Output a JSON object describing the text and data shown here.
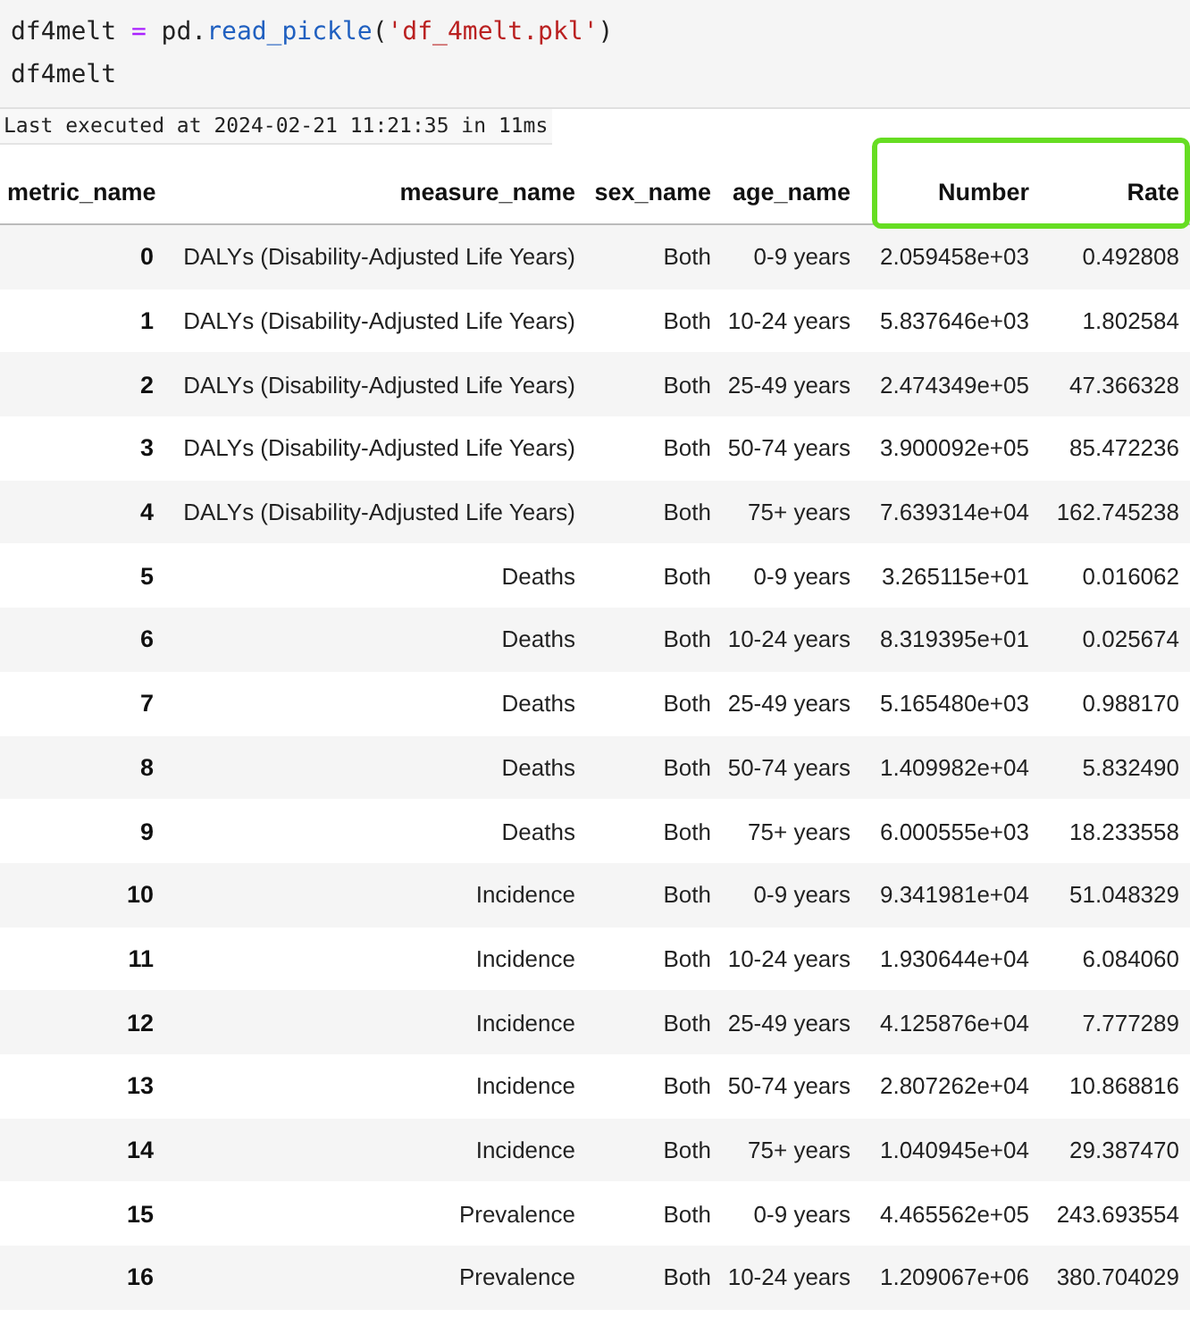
{
  "code_cell": {
    "lines": [
      [
        {
          "kind": "plain",
          "text": "df4melt "
        },
        {
          "kind": "operator",
          "text": "="
        },
        {
          "kind": "plain",
          "text": " pd."
        },
        {
          "kind": "function",
          "text": "read_pickle"
        },
        {
          "kind": "plain",
          "text": "("
        },
        {
          "kind": "string",
          "text": "'df_4melt.pkl'"
        },
        {
          "kind": "plain",
          "text": ")"
        }
      ],
      [
        {
          "kind": "plain",
          "text": "df4melt"
        }
      ]
    ]
  },
  "status": "Last executed at 2024-02-21 11:21:35 in 11ms",
  "table": {
    "columns": [
      {
        "label": "metric_name",
        "highlighted": false
      },
      {
        "label": "measure_name",
        "highlighted": false
      },
      {
        "label": "sex_name",
        "highlighted": false
      },
      {
        "label": "age_name",
        "highlighted": false
      },
      {
        "label": "Number",
        "highlighted": true
      },
      {
        "label": "Rate",
        "highlighted": true
      }
    ],
    "rows": [
      {
        "cells": [
          "0",
          "DALYs (Disability-Adjusted Life Years)",
          "Both",
          "0-9 years",
          "2.059458e+03",
          "0.492808"
        ]
      },
      {
        "cells": [
          "1",
          "DALYs (Disability-Adjusted Life Years)",
          "Both",
          "10-24 years",
          "5.837646e+03",
          "1.802584"
        ]
      },
      {
        "cells": [
          "2",
          "DALYs (Disability-Adjusted Life Years)",
          "Both",
          "25-49 years",
          "2.474349e+05",
          "47.366328"
        ]
      },
      {
        "cells": [
          "3",
          "DALYs (Disability-Adjusted Life Years)",
          "Both",
          "50-74 years",
          "3.900092e+05",
          "85.472236"
        ]
      },
      {
        "cells": [
          "4",
          "DALYs (Disability-Adjusted Life Years)",
          "Both",
          "75+ years",
          "7.639314e+04",
          "162.745238"
        ]
      },
      {
        "cells": [
          "5",
          "Deaths",
          "Both",
          "0-9 years",
          "3.265115e+01",
          "0.016062"
        ]
      },
      {
        "cells": [
          "6",
          "Deaths",
          "Both",
          "10-24 years",
          "8.319395e+01",
          "0.025674"
        ]
      },
      {
        "cells": [
          "7",
          "Deaths",
          "Both",
          "25-49 years",
          "5.165480e+03",
          "0.988170"
        ]
      },
      {
        "cells": [
          "8",
          "Deaths",
          "Both",
          "50-74 years",
          "1.409982e+04",
          "5.832490"
        ]
      },
      {
        "cells": [
          "9",
          "Deaths",
          "Both",
          "75+ years",
          "6.000555e+03",
          "18.233558"
        ]
      },
      {
        "cells": [
          "10",
          "Incidence",
          "Both",
          "0-9 years",
          "9.341981e+04",
          "51.048329"
        ]
      },
      {
        "cells": [
          "11",
          "Incidence",
          "Both",
          "10-24 years",
          "1.930644e+04",
          "6.084060"
        ]
      },
      {
        "cells": [
          "12",
          "Incidence",
          "Both",
          "25-49 years",
          "4.125876e+04",
          "7.777289"
        ]
      },
      {
        "cells": [
          "13",
          "Incidence",
          "Both",
          "50-74 years",
          "2.807262e+04",
          "10.868816"
        ]
      },
      {
        "cells": [
          "14",
          "Incidence",
          "Both",
          "75+ years",
          "1.040945e+04",
          "29.387470"
        ]
      },
      {
        "cells": [
          "15",
          "Prevalence",
          "Both",
          "0-9 years",
          "4.465562e+05",
          "243.693554"
        ]
      },
      {
        "cells": [
          "16",
          "Prevalence",
          "Both",
          "10-24 years",
          "1.209067e+06",
          "380.704029"
        ]
      }
    ]
  }
}
